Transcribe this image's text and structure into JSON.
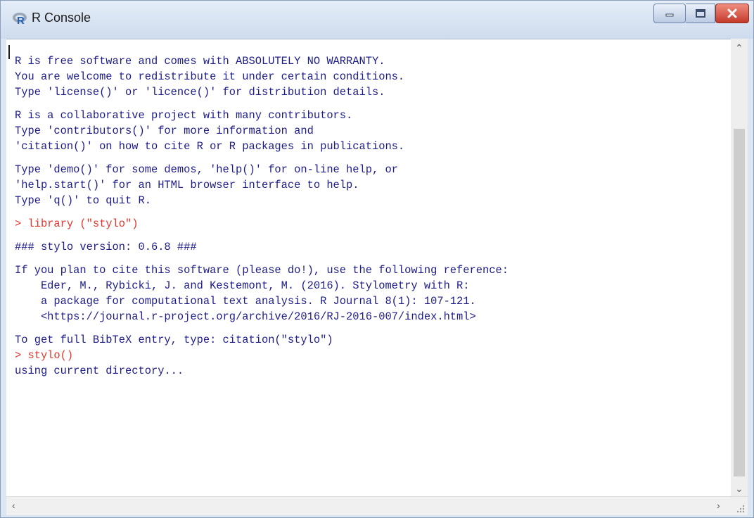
{
  "window": {
    "title": "R Console",
    "icon": "r-logo-icon",
    "controls": [
      "minimize-icon",
      "maximize-icon",
      "close-icon"
    ]
  },
  "console": {
    "lines": [
      {
        "text": "R is free software and comes with ABSOLUTELY NO WARRANTY.",
        "type": "output"
      },
      {
        "text": "You are welcome to redistribute it under certain conditions.",
        "type": "output"
      },
      {
        "text": "Type 'license()' or 'licence()' for distribution details.",
        "type": "output"
      },
      {
        "text": "",
        "type": "blank"
      },
      {
        "text": "R is a collaborative project with many contributors.",
        "type": "output"
      },
      {
        "text": "Type 'contributors()' for more information and",
        "type": "output"
      },
      {
        "text": "'citation()' on how to cite R or R packages in publications.",
        "type": "output"
      },
      {
        "text": "",
        "type": "blank"
      },
      {
        "text": "Type 'demo()' for some demos, 'help()' for on-line help, or",
        "type": "output"
      },
      {
        "text": "'help.start()' for an HTML browser interface to help.",
        "type": "output"
      },
      {
        "text": "Type 'q()' to quit R.",
        "type": "output"
      },
      {
        "text": "",
        "type": "blank"
      },
      {
        "text": "> library (\"stylo\")",
        "type": "input"
      },
      {
        "text": "",
        "type": "blank"
      },
      {
        "text": "### stylo version: 0.6.8 ###",
        "type": "output"
      },
      {
        "text": "",
        "type": "blank"
      },
      {
        "text": "If you plan to cite this software (please do!), use the following reference:",
        "type": "output"
      },
      {
        "text": "    Eder, M., Rybicki, J. and Kestemont, M. (2016). Stylometry with R:",
        "type": "output"
      },
      {
        "text": "    a package for computational text analysis. R Journal 8(1): 107-121.",
        "type": "output"
      },
      {
        "text": "    <https://journal.r-project.org/archive/2016/RJ-2016-007/index.html>",
        "type": "output"
      },
      {
        "text": "",
        "type": "blank"
      },
      {
        "text": "To get full BibTeX entry, type: citation(\"stylo\")",
        "type": "output"
      },
      {
        "text": "> stylo()",
        "type": "input"
      },
      {
        "text": "using current directory...",
        "type": "output"
      }
    ]
  },
  "colors": {
    "output_text": "#1c1c8a",
    "input_text": "#e3362b"
  }
}
